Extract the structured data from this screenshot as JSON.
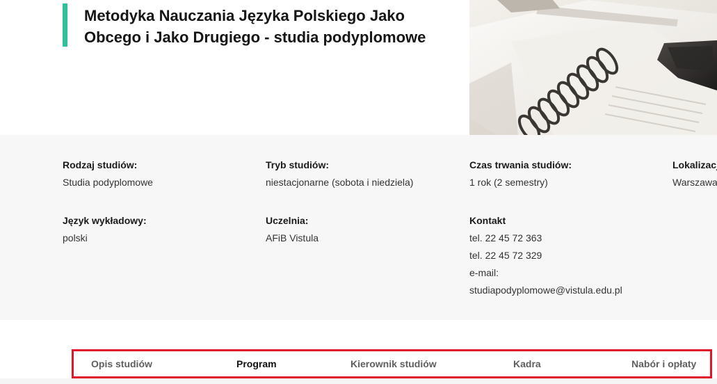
{
  "page": {
    "title": "Metodyka Nauczania Języka Polskiego Jako Obcego i Jako Drugiego - studia podyplomowe",
    "accent_color": "#2fbf9b",
    "highlight_color": "#e0162b"
  },
  "info": {
    "rodzaj": {
      "label": "Rodzaj studiów:",
      "value": "Studia podyplomowe"
    },
    "tryb": {
      "label": "Tryb studiów:",
      "value": "niestacjonarne (sobota i niedziela)"
    },
    "czas": {
      "label": "Czas trwania studiów:",
      "value": "1 rok (2 semestry)"
    },
    "lokalizacja": {
      "label": "Lokalizacj",
      "value": "Warszawa"
    },
    "jezyk": {
      "label": "Język wykładowy:",
      "value": "polski"
    },
    "uczelnia": {
      "label": "Uczelnia:",
      "value": "AFiB Vistula"
    },
    "kontakt": {
      "label": "Kontakt",
      "lines": [
        "tel. 22 45 72 363",
        "tel. 22 45 72 329",
        "e-mail:",
        "studiapodyplomowe@vistula.edu.pl"
      ]
    }
  },
  "tabs": {
    "items": [
      {
        "label": "Opis studiów",
        "active": false
      },
      {
        "label": "Program",
        "active": true
      },
      {
        "label": "Kierownik studiów",
        "active": false
      },
      {
        "label": "Kadra",
        "active": false
      },
      {
        "label": "Nabór i opłaty",
        "active": false
      }
    ]
  },
  "photo": {
    "icon": "notebook-photo"
  }
}
